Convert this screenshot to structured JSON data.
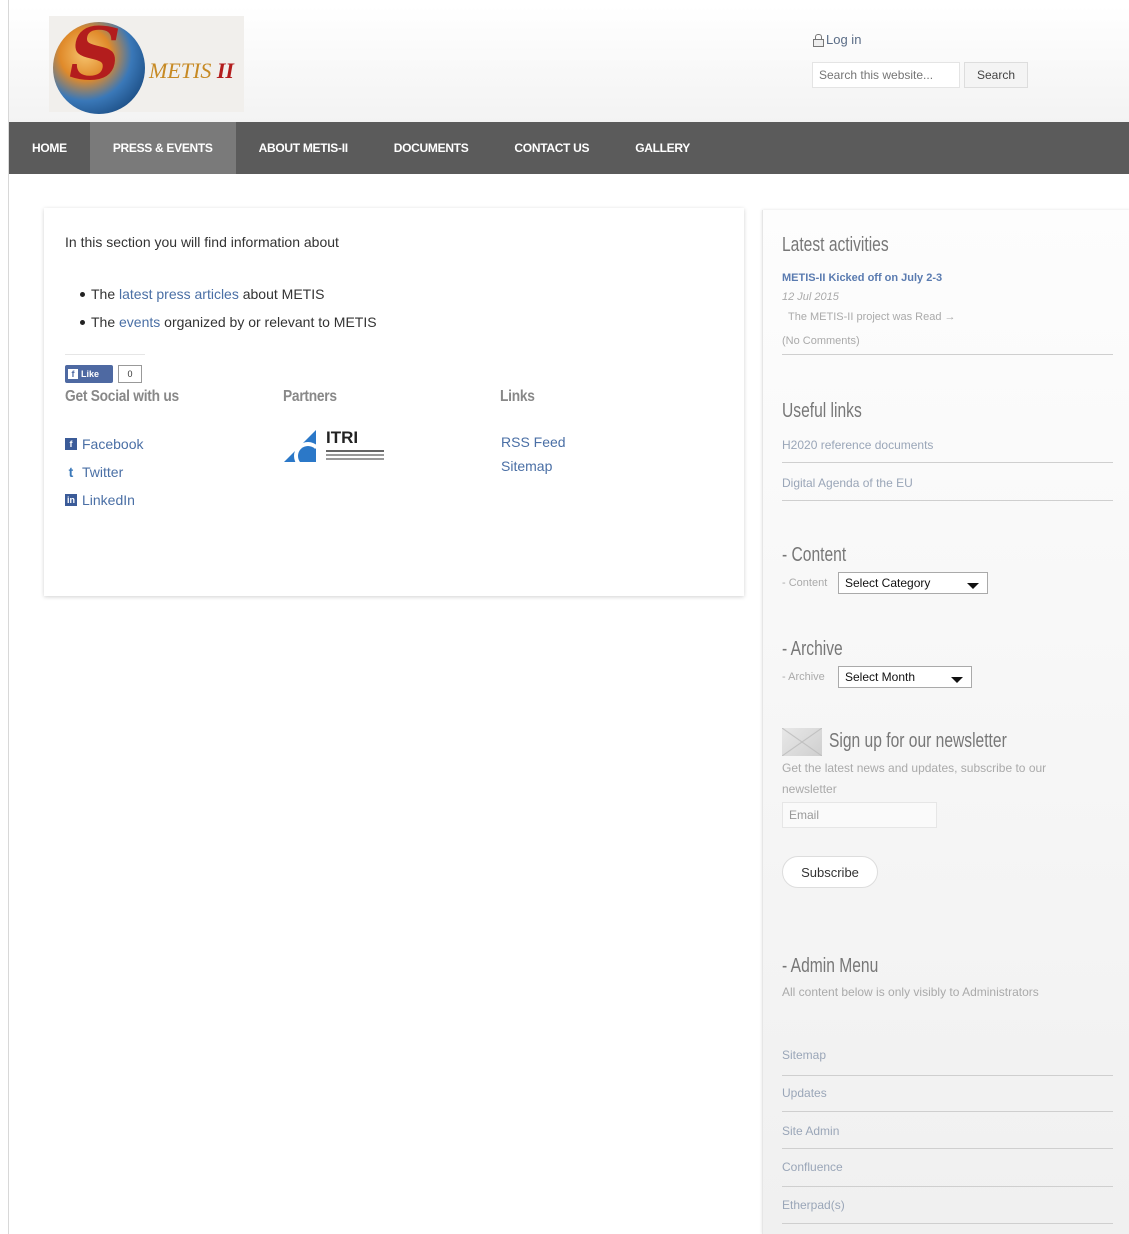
{
  "header": {
    "logo_text_a": "METIS",
    "logo_text_b": "II",
    "login_label": "Log in",
    "search_placeholder": "Search this website...",
    "search_button": "Search"
  },
  "nav": {
    "items": [
      "HOME",
      "PRESS & EVENTS",
      "ABOUT METIS-II",
      "DOCUMENTS",
      "CONTACT US",
      "GALLERY"
    ],
    "active": "PRESS & EVENTS"
  },
  "main": {
    "intro": "In this section you will find information about",
    "item1_pre": "The",
    "item1_link": "latest press articles",
    "item1_post": "about METIS",
    "item2_pre": "The",
    "item2_link": "events",
    "item2_post": "organized by or relevant to METIS",
    "like_label": "Like",
    "like_count": "0",
    "social_title": "Get Social with us",
    "partners_title": "Partners",
    "links_title": "Links",
    "social": [
      "Facebook",
      "Twitter",
      "LinkedIn"
    ],
    "partner_name": "ITRI",
    "links": [
      "RSS Feed",
      "Sitemap"
    ]
  },
  "sidebar": {
    "latest_title": "Latest activities",
    "post_title": "METIS-II Kicked off on July 2-3",
    "post_date": "12 Jul 2015",
    "post_excerpt": "The METIS-II project was Read →",
    "post_comments": "(No Comments)",
    "useful_title": "Useful links",
    "useful_links": [
      "H2020 reference documents",
      "Digital Agenda of the EU"
    ],
    "content_title": "- Content",
    "content_label": "- Content",
    "content_select": "Select Category",
    "archive_title": "- Archive",
    "archive_label": "- Archive",
    "archive_select": "Select Month",
    "newsletter_title": "Sign up for our newsletter",
    "newsletter_desc_1": "Get the latest news and updates, subscribe to our",
    "newsletter_desc_2": "newsletter",
    "email_placeholder": "Email",
    "subscribe_label": "Subscribe",
    "admin_title": "- Admin Menu",
    "admin_desc": "All content below is only visibly to Administrators",
    "admin_links": [
      "Sitemap",
      "Updates",
      "Site Admin",
      "Confluence",
      "Etherpad(s)"
    ]
  }
}
